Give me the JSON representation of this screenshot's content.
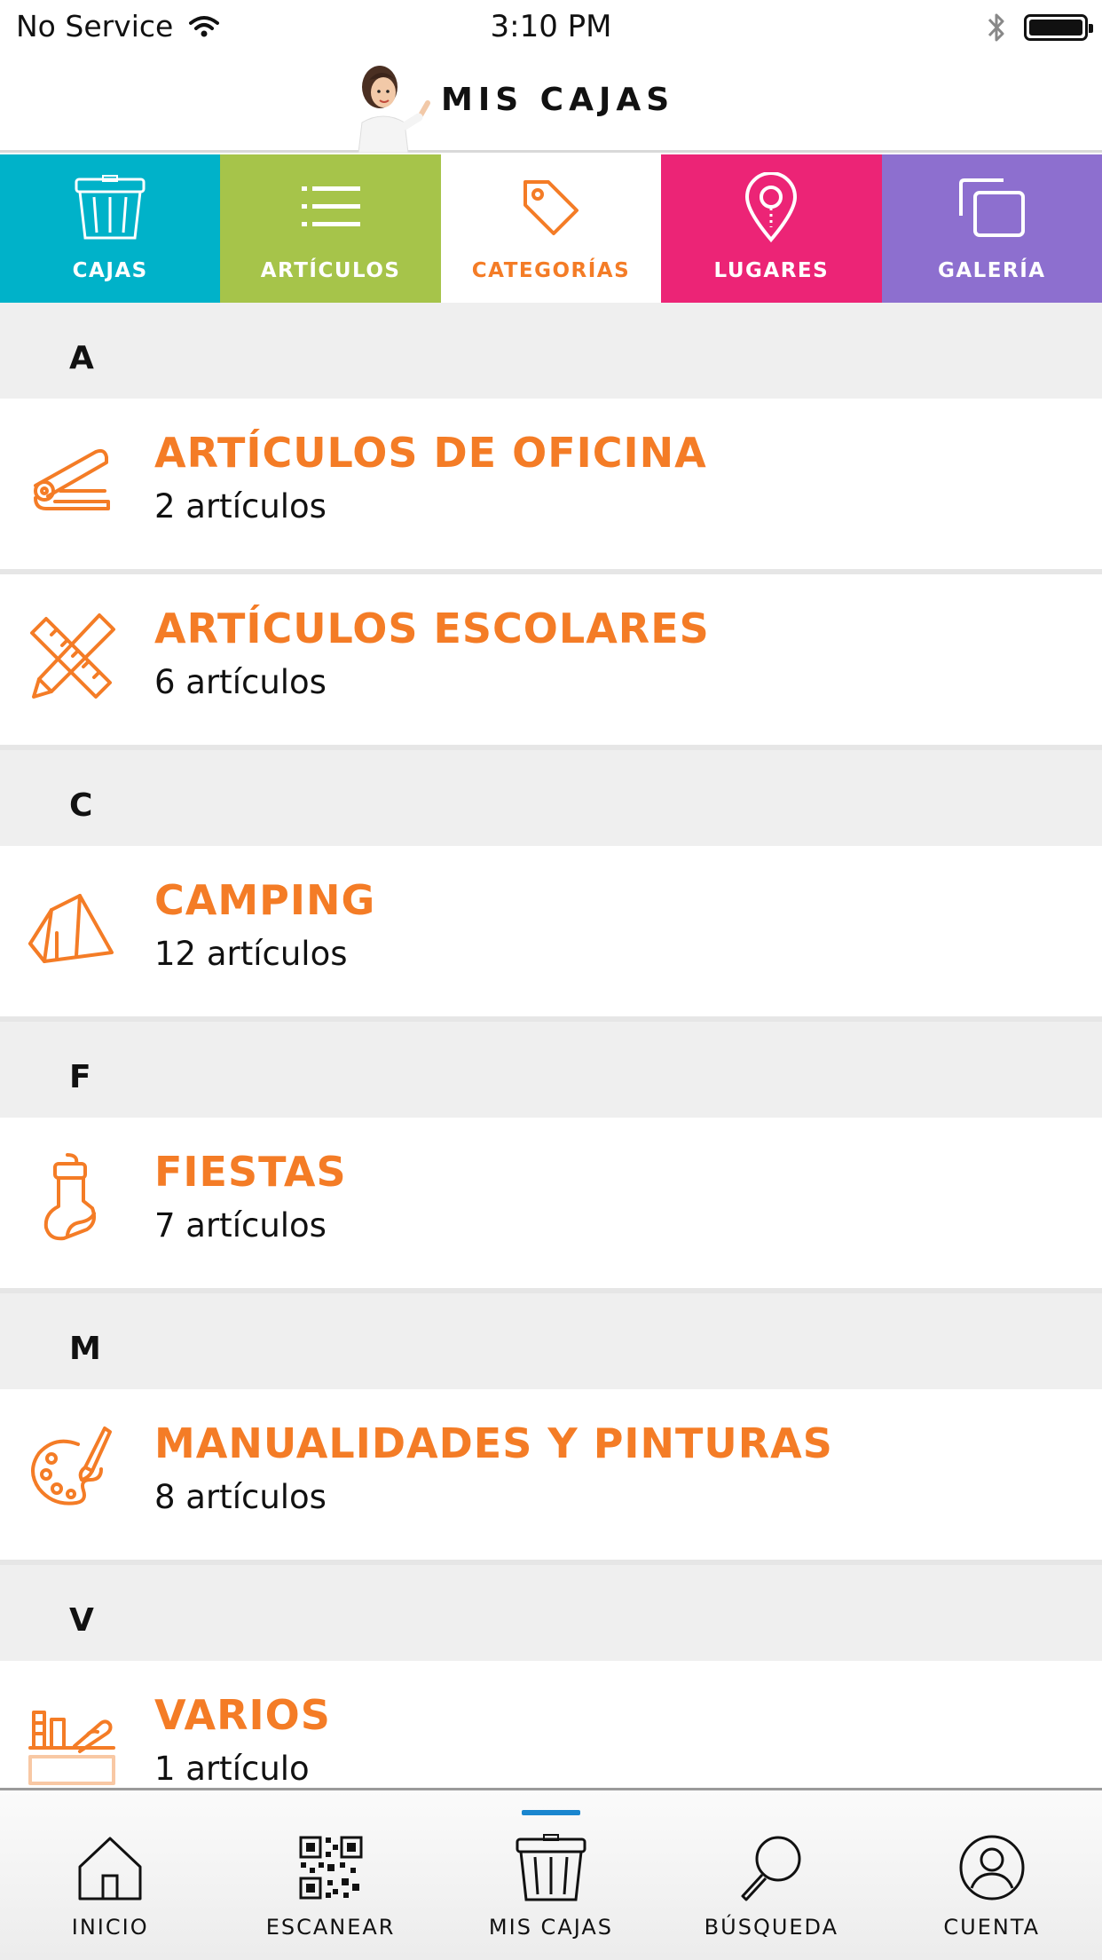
{
  "status_bar": {
    "carrier": "No Service",
    "time": "3:10 PM"
  },
  "header": {
    "title": "MIS CAJAS"
  },
  "top_tabs": [
    {
      "label": "CAJAS",
      "icon": "box-icon",
      "color": "#00b2c9",
      "active": false
    },
    {
      "label": "ARTÍCULOS",
      "icon": "list-icon",
      "color": "#a6c44a",
      "active": false
    },
    {
      "label": "CATEGORÍAS",
      "icon": "tag-icon",
      "color": "#ffffff",
      "active": true
    },
    {
      "label": "LUGARES",
      "icon": "location-pin-icon",
      "color": "#ec2476",
      "active": false
    },
    {
      "label": "GALERÍA",
      "icon": "gallery-icon",
      "color": "#8d6fcf",
      "active": false
    }
  ],
  "sections": [
    {
      "letter": "A",
      "items": [
        {
          "title": "ARTÍCULOS DE OFICINA",
          "count": "2 artículos",
          "icon": "stapler-icon"
        },
        {
          "title": "ARTÍCULOS ESCOLARES",
          "count": "6 artículos",
          "icon": "ruler-pencil-icon"
        }
      ]
    },
    {
      "letter": "C",
      "items": [
        {
          "title": "CAMPING",
          "count": "12 artículos",
          "icon": "tent-icon"
        }
      ]
    },
    {
      "letter": "F",
      "items": [
        {
          "title": "FIESTAS",
          "count": "7 artículos",
          "icon": "stocking-icon"
        }
      ]
    },
    {
      "letter": "M",
      "items": [
        {
          "title": "MANUALIDADES Y PINTURAS",
          "count": "8 artículos",
          "icon": "palette-icon"
        }
      ]
    },
    {
      "letter": "V",
      "items": [
        {
          "title": "VARIOS",
          "count": "1 artículo",
          "icon": "misc-tools-icon"
        }
      ]
    }
  ],
  "bottom_nav": [
    {
      "label": "INICIO",
      "icon": "home-icon",
      "active": false
    },
    {
      "label": "ESCANEAR",
      "icon": "qr-code-icon",
      "active": false
    },
    {
      "label": "MIS CAJAS",
      "icon": "box-icon",
      "active": true
    },
    {
      "label": "BÚSQUEDA",
      "icon": "search-icon",
      "active": false
    },
    {
      "label": "CUENTA",
      "icon": "user-icon",
      "active": false
    }
  ],
  "colors": {
    "accent_orange": "#f47c26",
    "active_indicator": "#1a86cf"
  }
}
